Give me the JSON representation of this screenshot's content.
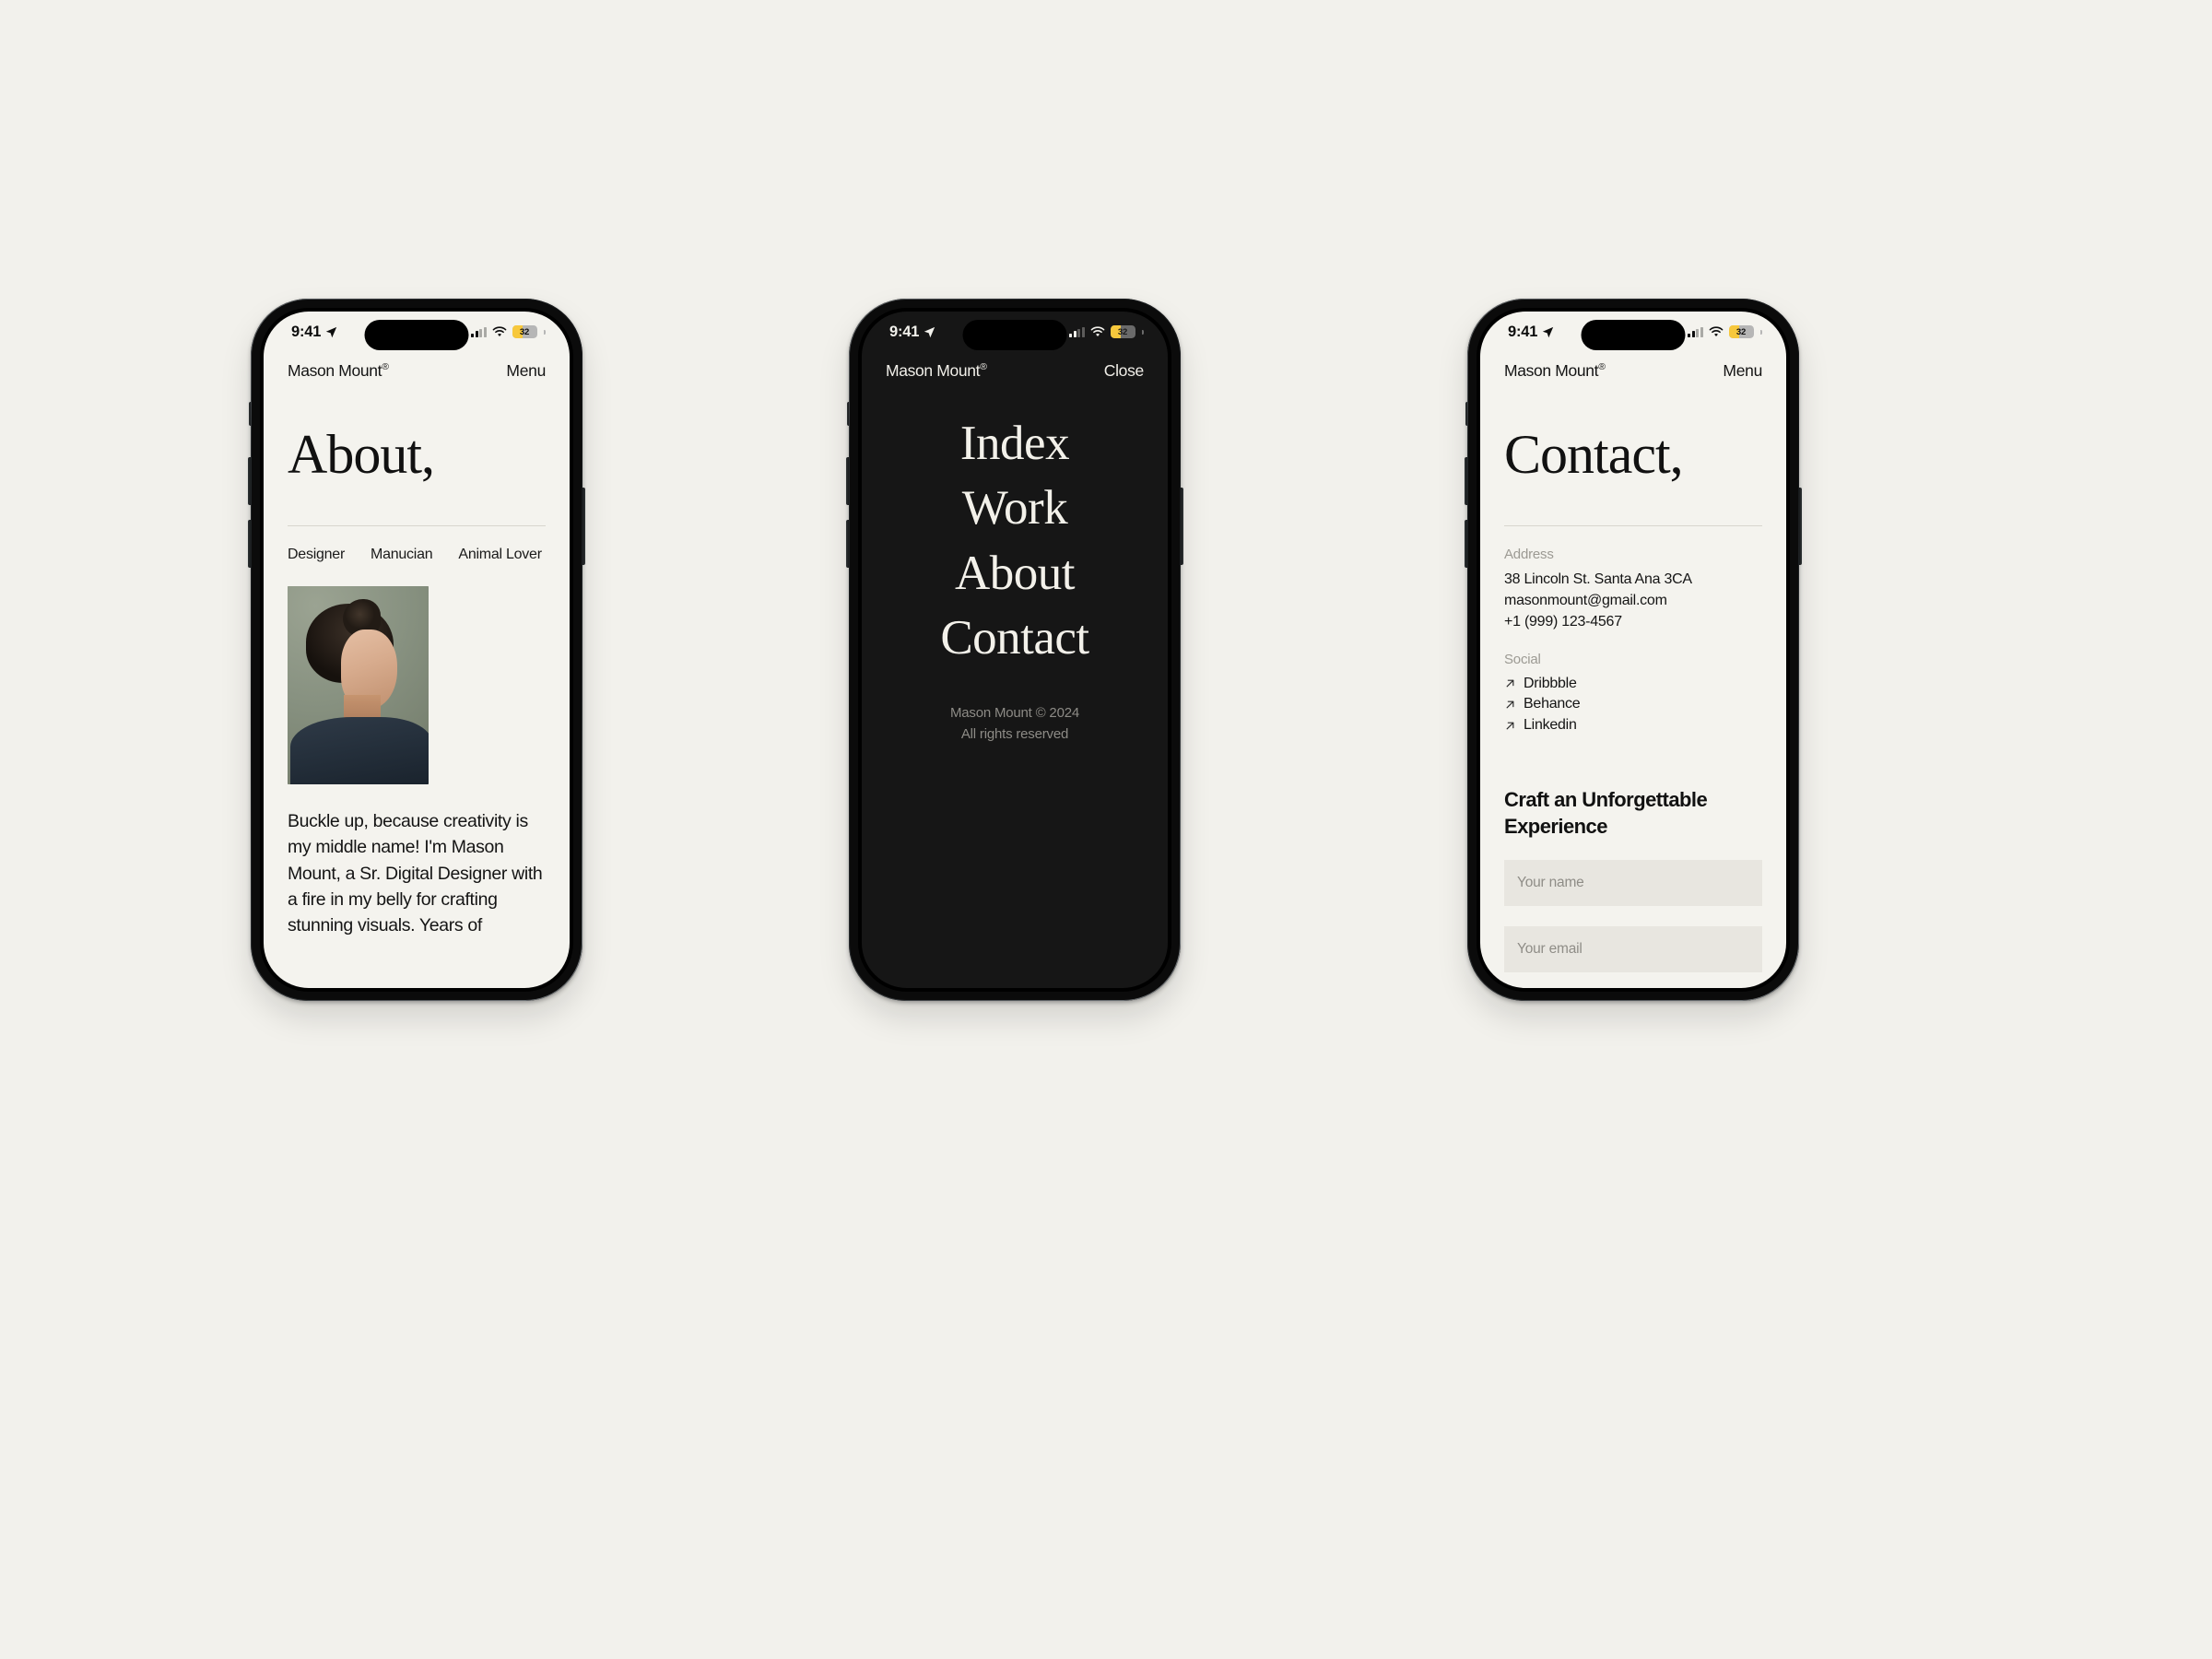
{
  "statusbar": {
    "time": "9:41",
    "battery_percent": "32",
    "icons": [
      "location-arrow-icon",
      "cellular-signal-icon",
      "wifi-icon",
      "battery-icon"
    ]
  },
  "phones": [
    {
      "name": "about-screen",
      "theme": "light",
      "header": {
        "brand": "Mason Mount",
        "brand_mark": "®",
        "action": "Menu"
      },
      "title": "About,",
      "tags": [
        "Designer",
        "Manucian",
        "Animal Lover"
      ],
      "portrait_alt": "portrait-photo-of-mason-mount",
      "body": "Buckle up, because creativity is my middle name! I'm Mason Mount, a Sr. Digital Designer with a fire in my belly for crafting stunning visuals. Years of"
    },
    {
      "name": "menu-screen",
      "theme": "dark",
      "header": {
        "brand": "Mason Mount",
        "brand_mark": "®",
        "action": "Close"
      },
      "menu_items": [
        "Index",
        "Work",
        "About",
        "Contact"
      ],
      "footer": {
        "copyright": "Mason Mount © 2024",
        "rights": "All rights reserved"
      }
    },
    {
      "name": "contact-screen",
      "theme": "light",
      "header": {
        "brand": "Mason Mount",
        "brand_mark": "®",
        "action": "Menu"
      },
      "title": "Contact,",
      "address_label": "Address",
      "address_lines": [
        "38 Lincoln St. Santa Ana 3CA",
        "masonmount@gmail.com",
        "+1 (999) 123-4567"
      ],
      "social_label": "Social",
      "social_links": [
        "Dribbble",
        "Behance",
        "Linkedin"
      ],
      "form": {
        "title": "Craft an Unforgettable Experience",
        "name_placeholder": "Your name",
        "email_placeholder": "Your email"
      }
    }
  ],
  "colors": {
    "page_background": "#f2f1ec",
    "screen_light": "#f4f3ee",
    "screen_dark": "#161616",
    "text_primary": "#141414",
    "text_muted": "#9c9a93",
    "battery_fill": "#f7c83c",
    "input_background": "#e8e6e0"
  }
}
